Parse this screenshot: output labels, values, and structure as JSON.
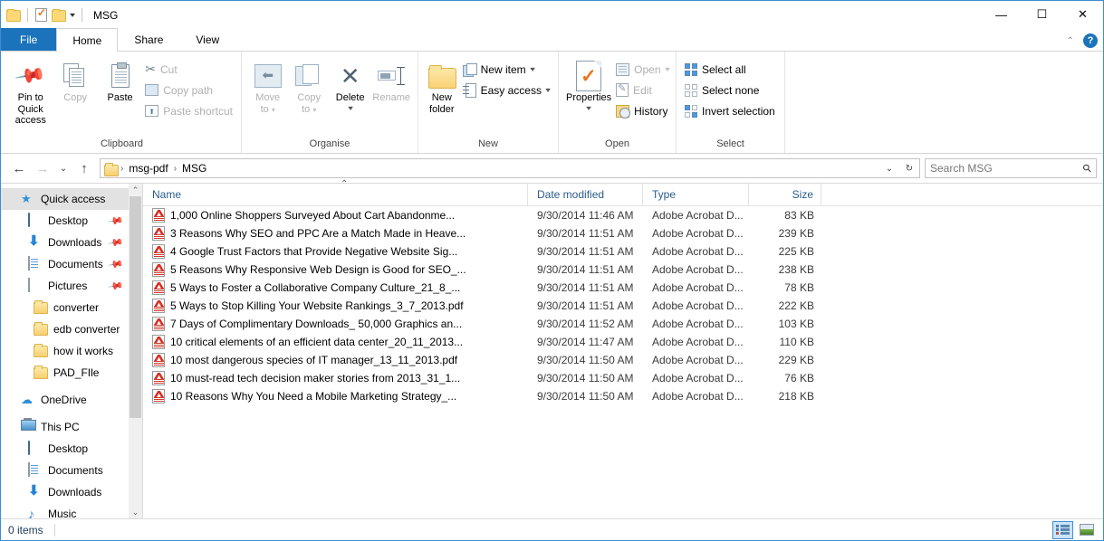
{
  "window": {
    "title": "MSG",
    "quick_access_icons": [
      "folder-icon",
      "properties-check-icon",
      "folder-icon"
    ],
    "controls": {
      "minimize": "—",
      "maximize": "☐",
      "close": "✕"
    },
    "ribbon_collapse": "⌃",
    "help": "?"
  },
  "tabs": [
    {
      "label": "File",
      "id": "file"
    },
    {
      "label": "Home",
      "id": "home"
    },
    {
      "label": "Share",
      "id": "share"
    },
    {
      "label": "View",
      "id": "view"
    }
  ],
  "ribbon": {
    "groups": [
      {
        "name": "Clipboard",
        "label": "Clipboard",
        "big": [
          {
            "label": "Pin to Quick\naccess",
            "line1": "Pin to Quick",
            "line2": "access",
            "icon": "pin-icon",
            "disabled": false
          },
          {
            "label": "Copy",
            "line1": "Copy",
            "line2": "",
            "icon": "copy-icon",
            "disabled": true
          },
          {
            "label": "Paste",
            "line1": "Paste",
            "line2": "",
            "icon": "paste-icon",
            "disabled": false
          }
        ],
        "small": [
          {
            "label": "Cut",
            "icon": "scissors-icon",
            "disabled": true
          },
          {
            "label": "Copy path",
            "icon": "copy-path-icon",
            "disabled": true
          },
          {
            "label": "Paste shortcut",
            "icon": "paste-shortcut-icon",
            "disabled": true
          }
        ]
      },
      {
        "name": "Organise",
        "label": "Organise",
        "big": [
          {
            "line1": "Move",
            "line2": "to",
            "icon": "move-to-icon",
            "disabled": true,
            "caret": true
          },
          {
            "line1": "Copy",
            "line2": "to",
            "icon": "copy-to-icon",
            "disabled": true,
            "caret": true
          },
          {
            "line1": "Delete",
            "line2": "",
            "icon": "delete-icon",
            "disabled": false,
            "caret": true
          },
          {
            "line1": "Rename",
            "line2": "",
            "icon": "rename-icon",
            "disabled": true,
            "caret": false
          }
        ]
      },
      {
        "name": "New",
        "label": "New",
        "big": [
          {
            "line1": "New",
            "line2": "folder",
            "icon": "new-folder-icon",
            "disabled": false
          }
        ],
        "small": [
          {
            "label": "New item",
            "icon": "new-item-icon",
            "disabled": false,
            "caret": true
          },
          {
            "label": "Easy access",
            "icon": "easy-access-icon",
            "disabled": false,
            "caret": true
          }
        ]
      },
      {
        "name": "Open",
        "label": "Open",
        "big": [
          {
            "line1": "Properties",
            "line2": "",
            "icon": "properties-icon",
            "disabled": false,
            "caret": true
          }
        ],
        "small": [
          {
            "label": "Open",
            "icon": "open-icon",
            "disabled": true,
            "caret": true
          },
          {
            "label": "Edit",
            "icon": "edit-icon",
            "disabled": true
          },
          {
            "label": "History",
            "icon": "history-icon",
            "disabled": false
          }
        ]
      },
      {
        "name": "Select",
        "label": "Select",
        "small": [
          {
            "label": "Select all",
            "icon": "select-all-icon",
            "disabled": false
          },
          {
            "label": "Select none",
            "icon": "select-none-icon",
            "disabled": false
          },
          {
            "label": "Invert selection",
            "icon": "invert-selection-icon",
            "disabled": false
          }
        ]
      }
    ]
  },
  "addressbar": {
    "back": "←",
    "forward": "→",
    "recent": "⌄",
    "up": "↑",
    "breadcrumbs": [
      "msg-pdf",
      "MSG"
    ],
    "separator": "›",
    "dropdown": "⌄",
    "refresh": "↻"
  },
  "search": {
    "placeholder": "Search MSG",
    "icon": "search-icon"
  },
  "sidebar": {
    "items": [
      {
        "label": "Quick access",
        "icon": "star-pin-icon",
        "indent": 0,
        "selected": true,
        "pinned": false
      },
      {
        "label": "Desktop",
        "icon": "desktop-icon",
        "indent": 1,
        "selected": false,
        "pinned": true
      },
      {
        "label": "Downloads",
        "icon": "downloads-icon",
        "indent": 1,
        "selected": false,
        "pinned": true
      },
      {
        "label": "Documents",
        "icon": "documents-icon",
        "indent": 1,
        "selected": false,
        "pinned": true
      },
      {
        "label": "Pictures",
        "icon": "pictures-icon",
        "indent": 1,
        "selected": false,
        "pinned": true
      },
      {
        "label": "converter",
        "icon": "folder-icon",
        "indent": 1,
        "selected": false,
        "pinned": false
      },
      {
        "label": "edb converter",
        "icon": "folder-icon",
        "indent": 1,
        "selected": false,
        "pinned": false
      },
      {
        "label": "how it works",
        "icon": "folder-icon",
        "indent": 1,
        "selected": false,
        "pinned": false
      },
      {
        "label": "PAD_FIle",
        "icon": "folder-icon",
        "indent": 1,
        "selected": false,
        "pinned": false
      },
      {
        "label": "OneDrive",
        "icon": "onedrive-icon",
        "indent": 0,
        "selected": false,
        "pinned": false,
        "gap_before": true
      },
      {
        "label": "This PC",
        "icon": "this-pc-icon",
        "indent": 0,
        "selected": false,
        "pinned": false,
        "gap_before": true
      },
      {
        "label": "Desktop",
        "icon": "desktop-icon",
        "indent": 1,
        "selected": false,
        "pinned": false
      },
      {
        "label": "Documents",
        "icon": "documents-icon",
        "indent": 1,
        "selected": false,
        "pinned": false
      },
      {
        "label": "Downloads",
        "icon": "downloads-icon",
        "indent": 1,
        "selected": false,
        "pinned": false
      },
      {
        "label": "Music",
        "icon": "music-icon",
        "indent": 1,
        "selected": false,
        "pinned": false
      }
    ],
    "scroll_up": "⌃",
    "scroll_down": "⌄"
  },
  "filelist": {
    "columns": [
      {
        "key": "name",
        "label": "Name",
        "sorted": "asc"
      },
      {
        "key": "date",
        "label": "Date modified",
        "sorted": ""
      },
      {
        "key": "type",
        "label": "Type",
        "sorted": ""
      },
      {
        "key": "size",
        "label": "Size",
        "sorted": ""
      }
    ],
    "sort_indicator": "⌃",
    "rows": [
      {
        "name": "1,000 Online Shoppers Surveyed About Cart Abandonme...",
        "date": "9/30/2014 11:46 AM",
        "type": "Adobe Acrobat D...",
        "size": "83 KB",
        "icon": "pdf-icon"
      },
      {
        "name": "3 Reasons Why SEO and PPC Are a Match Made in Heave...",
        "date": "9/30/2014 11:51 AM",
        "type": "Adobe Acrobat D...",
        "size": "239 KB",
        "icon": "pdf-icon"
      },
      {
        "name": "4 Google Trust Factors that Provide Negative Website Sig...",
        "date": "9/30/2014 11:51 AM",
        "type": "Adobe Acrobat D...",
        "size": "225 KB",
        "icon": "pdf-icon"
      },
      {
        "name": "5 Reasons Why Responsive Web Design is Good for SEO_...",
        "date": "9/30/2014 11:51 AM",
        "type": "Adobe Acrobat D...",
        "size": "238 KB",
        "icon": "pdf-icon"
      },
      {
        "name": "5 Ways to Foster a Collaborative Company Culture_21_8_...",
        "date": "9/30/2014 11:51 AM",
        "type": "Adobe Acrobat D...",
        "size": "78 KB",
        "icon": "pdf-icon"
      },
      {
        "name": "5 Ways to Stop Killing Your Website Rankings_3_7_2013.pdf",
        "date": "9/30/2014 11:51 AM",
        "type": "Adobe Acrobat D...",
        "size": "222 KB",
        "icon": "pdf-icon"
      },
      {
        "name": "7 Days of Complimentary Downloads_ 50,000 Graphics an...",
        "date": "9/30/2014 11:52 AM",
        "type": "Adobe Acrobat D...",
        "size": "103 KB",
        "icon": "pdf-icon"
      },
      {
        "name": "10 critical elements of an efficient data center_20_11_2013...",
        "date": "9/30/2014 11:47 AM",
        "type": "Adobe Acrobat D...",
        "size": "110 KB",
        "icon": "pdf-icon"
      },
      {
        "name": "10 most dangerous species of IT manager_13_11_2013.pdf",
        "date": "9/30/2014 11:50 AM",
        "type": "Adobe Acrobat D...",
        "size": "229 KB",
        "icon": "pdf-icon"
      },
      {
        "name": "10 must-read tech decision maker stories from 2013_31_1...",
        "date": "9/30/2014 11:50 AM",
        "type": "Adobe Acrobat D...",
        "size": "76 KB",
        "icon": "pdf-icon"
      },
      {
        "name": "10 Reasons Why You Need a Mobile Marketing Strategy_...",
        "date": "9/30/2014 11:50 AM",
        "type": "Adobe Acrobat D...",
        "size": "218 KB",
        "icon": "pdf-icon"
      }
    ]
  },
  "statusbar": {
    "item_count": "0 items",
    "views": [
      {
        "name": "details-view",
        "active": true
      },
      {
        "name": "large-icons-view",
        "active": false
      }
    ]
  },
  "colors": {
    "accent": "#1b74bb",
    "window_border": "#3f8fd2",
    "header_text": "#2b5c8a",
    "selection": "#e2e2e2",
    "pdf_red": "#d93025",
    "check_orange": "#e8761b"
  }
}
